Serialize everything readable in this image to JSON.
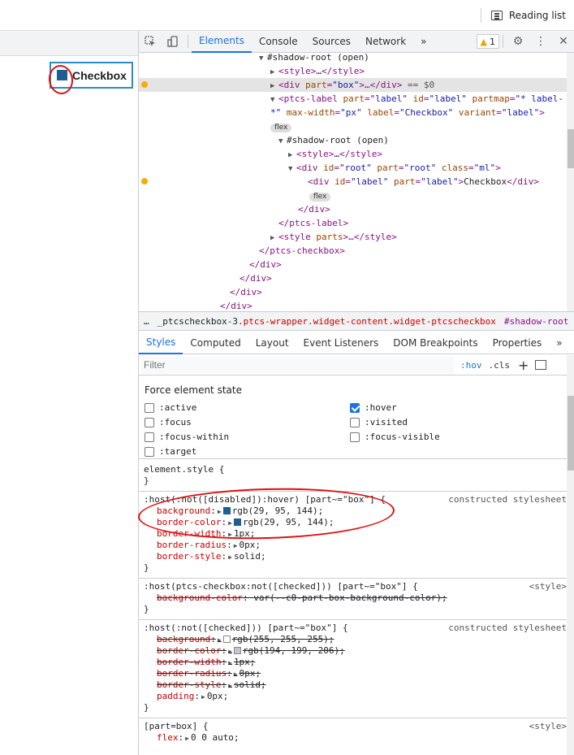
{
  "browser": {
    "reading_list_label": "Reading list",
    "reading_list_icon": "reading-list-icon"
  },
  "page": {
    "checkbox_label": "Checkbox",
    "checkbox_color": "#1d5f90"
  },
  "devtools": {
    "toolbar": {
      "tabs": [
        "Elements",
        "Console",
        "Sources",
        "Network"
      ],
      "active_tab": "Elements",
      "more": "»",
      "warning_count": "1"
    },
    "dom": {
      "line0": "#shadow-root (open)",
      "line1_tag": "<style>",
      "line1_ell": "…",
      "line1_end": "</style>",
      "line2_a": "<div ",
      "line2_attr": "part",
      "line2_val": "\"box\"",
      "line2_b": ">…</div>",
      "line2_eq": " == $0",
      "line3_a": "<ptcs-label ",
      "line3_part": "part",
      "line3_partv": "\"label\"",
      "line3_id": "id",
      "line3_idv": "\"label\"",
      "line3_partmap": "partmap",
      "line3_partmapv": "\"* label-",
      "line4_a": "*\"",
      "line4_mw": "max-width",
      "line4_mwv": "\"px\"",
      "line4_label": "label",
      "line4_labelv": "\"Checkbox\"",
      "line4_variant": "variant",
      "line4_variantv": "\"label\"",
      "line4_end": ">",
      "flex": "flex",
      "line6": "#shadow-root (open)",
      "line7_tag": "<style>",
      "line7_ell": "…",
      "line7_end": "</style>",
      "line8_a": "<div ",
      "line8_id": "id",
      "line8_idv": "\"root\"",
      "line8_part": "part",
      "line8_partv": "\"root\"",
      "line8_class": "class",
      "line8_classv": "\"ml\"",
      "line8_end": ">",
      "line9_a": "<div ",
      "line9_id": "id",
      "line9_idv": "\"label\"",
      "line9_part": "part",
      "line9_partv": "\"label\"",
      "line9_b": ">",
      "line9_text": "Checkbox",
      "line9_end": "</div>",
      "line11": "</div>",
      "line12": "</ptcs-label>",
      "line13_a": "<style ",
      "line13_attr": "parts",
      "line13_b": ">…</style>",
      "line14": "</ptcs-checkbox>",
      "line15": "</div>",
      "line16": "</div>",
      "line17": "</div>",
      "line18": "</div>"
    },
    "breadcrumb": {
      "ellipsis": "…",
      "item1": "_ptcscheckbox-3",
      "item1_class": ".ptcs-wrapper.widget-content.widget-ptcscheckbox",
      "item2": "#shadow-root",
      "item3": "div"
    },
    "styles_tabs": [
      "Styles",
      "Computed",
      "Layout",
      "Event Listeners",
      "DOM Breakpoints",
      "Properties"
    ],
    "styles_tabs_more": "»",
    "filter": {
      "placeholder": "Filter",
      "hov": ":hov",
      "cls": ".cls",
      "plus": "+"
    },
    "force_state": {
      "title": "Force element state",
      "states": [
        {
          "label": ":active",
          "checked": false
        },
        {
          "label": ":focus",
          "checked": false
        },
        {
          "label": ":focus-within",
          "checked": false
        },
        {
          "label": ":target",
          "checked": false
        },
        {
          "label": ":hover",
          "checked": true
        },
        {
          "label": ":visited",
          "checked": false
        },
        {
          "label": ":focus-visible",
          "checked": false
        }
      ]
    },
    "rules": {
      "r0_sel": "element.style {",
      "r0_end": "}",
      "r1_sel": ":host(:not([disabled]):hover) [part~=\"box\"] {",
      "r1_src": "constructed stylesheet",
      "r1_p1": "background",
      "r1_v1": "rgb(29, 95, 144);",
      "r1_c1": "#1d5f90",
      "r1_p2": "border-color",
      "r1_v2": "rgb(29, 95, 144);",
      "r1_c2": "#1d5f90",
      "r1_p3": "border-width",
      "r1_v3": "1px;",
      "r1_p4": "border-radius",
      "r1_v4": "0px;",
      "r1_p5": "border-style",
      "r1_v5": "solid;",
      "r1_end": "}",
      "r2_sel": ":host(ptcs-checkbox:not([checked])) [part~=\"box\"] {",
      "r2_src": "<style>",
      "r2_p1": "background-color",
      "r2_v1": "var(--c0-part-box-background-color);",
      "r2_end": "}",
      "r3_sel": ":host(:not([checked])) [part~=\"box\"] {",
      "r3_src": "constructed stylesheet",
      "r3_p1": "background",
      "r3_v1": "rgb(255, 255, 255);",
      "r3_c1": "#ffffff",
      "r3_p2": "border-color",
      "r3_v2": "rgb(194, 199, 206);",
      "r3_c2": "#c2c7ce",
      "r3_p3": "border-width",
      "r3_v3": "1px;",
      "r3_p4": "border-radius",
      "r3_v4": "0px;",
      "r3_p5": "border-style",
      "r3_v5": "solid;",
      "r3_p6": "padding",
      "r3_v6": "0px;",
      "r3_end": "}",
      "r4_sel": "[part=box] {",
      "r4_src": "<style>",
      "r4_p1": "flex",
      "r4_v1": "0 0 auto;"
    }
  },
  "colors": {
    "accent": "#1a73e8",
    "annotation": "#dd1111",
    "warning": "#f9ab00"
  }
}
